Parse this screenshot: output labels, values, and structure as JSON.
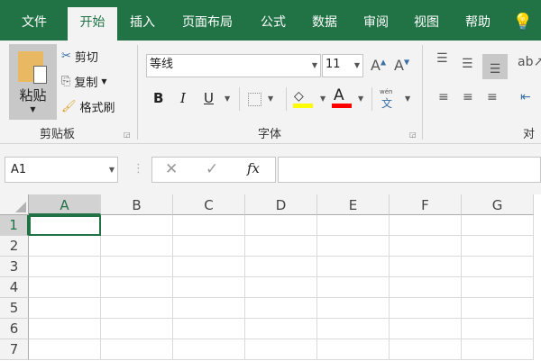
{
  "tabs": [
    "文件",
    "开始",
    "插入",
    "页面布局",
    "公式",
    "数据",
    "审阅",
    "视图",
    "帮助"
  ],
  "active_tab": "开始",
  "clipboard": {
    "paste": "粘贴",
    "cut": "剪切",
    "copy": "复制",
    "format_painter": "格式刷",
    "group": "剪贴板"
  },
  "font": {
    "name": "等线",
    "size": "11",
    "bold": "B",
    "italic": "I",
    "underline": "U",
    "font_color_letter": "A",
    "phonetic_top": "wén",
    "phonetic_bottom": "文",
    "group": "字体",
    "highlight_color": "#ffff00",
    "font_color": "#ff0000"
  },
  "alignment": {
    "group": "对齐"
  },
  "formula_bar": {
    "name_box": "A1",
    "cancel": "✕",
    "enter": "✓",
    "fx": "fx",
    "value": ""
  },
  "columns": [
    "A",
    "B",
    "C",
    "D",
    "E",
    "F",
    "G"
  ],
  "rows": [
    "1",
    "2",
    "3",
    "4",
    "5",
    "6",
    "7"
  ],
  "accent": "#217346"
}
